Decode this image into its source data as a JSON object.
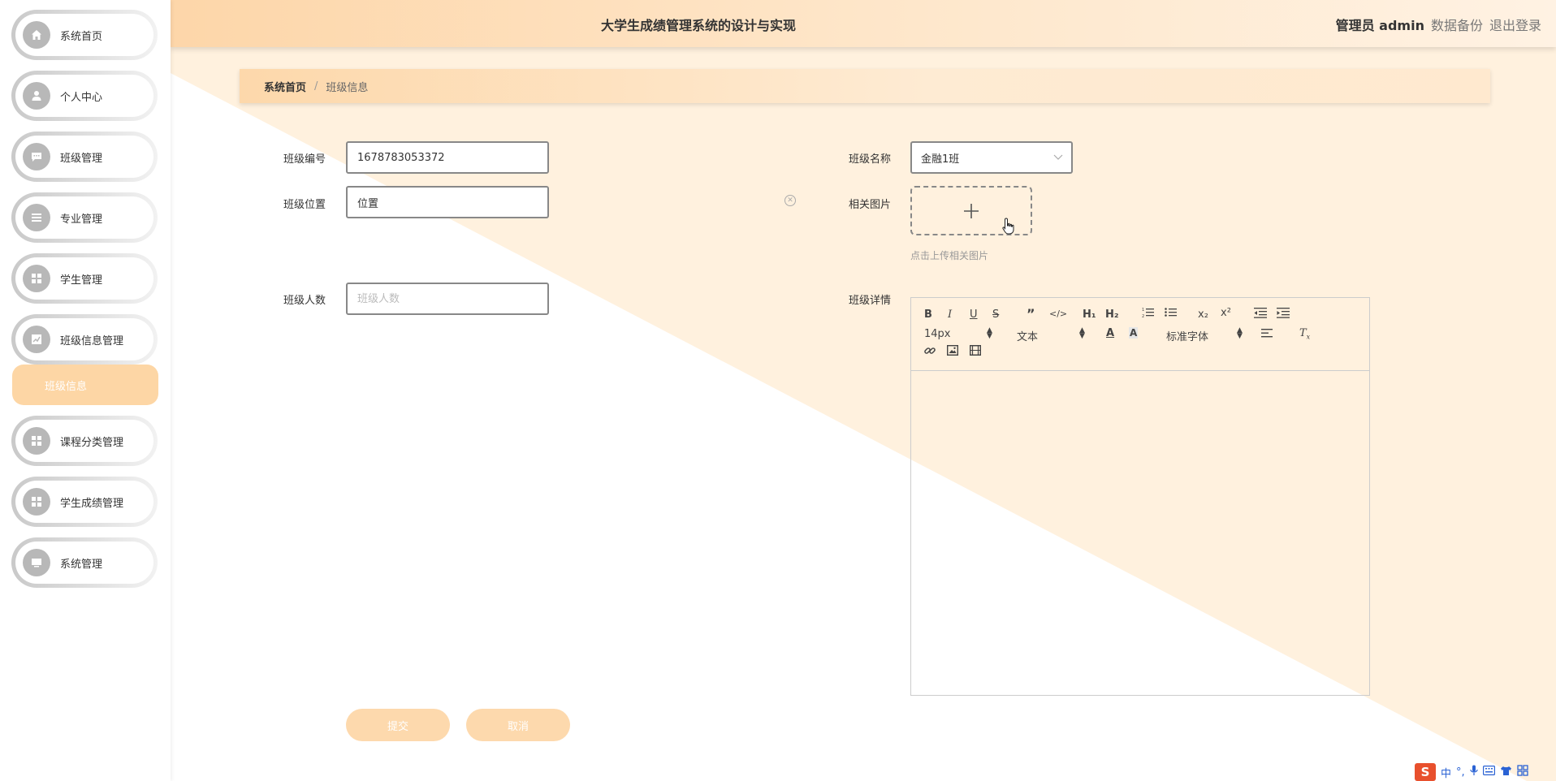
{
  "header": {
    "title": "大学生成绩管理系统的设计与实现",
    "user_label": "管理员 admin",
    "backup_label": "数据备份",
    "logout_label": "退出登录"
  },
  "sidebar": {
    "items": [
      {
        "label": "系统首页",
        "icon": "home-icon"
      },
      {
        "label": "个人中心",
        "icon": "user-icon"
      },
      {
        "label": "班级管理",
        "icon": "chat-icon"
      },
      {
        "label": "专业管理",
        "icon": "list-icon"
      },
      {
        "label": "学生管理",
        "icon": "grid-icon"
      },
      {
        "label": "班级信息管理",
        "icon": "chart-icon"
      },
      {
        "label": "课程分类管理",
        "icon": "grid-icon"
      },
      {
        "label": "学生成绩管理",
        "icon": "grid-icon"
      },
      {
        "label": "系统管理",
        "icon": "monitor-icon"
      }
    ],
    "active_submenu": "班级信息"
  },
  "breadcrumb": {
    "home": "系统首页",
    "separator": "/",
    "current": "班级信息"
  },
  "form": {
    "class_no_label": "班级编号",
    "class_no_value": "1678783053372",
    "class_location_label": "班级位置",
    "class_location_value": "位置",
    "class_size_label": "班级人数",
    "class_size_placeholder": "班级人数",
    "class_name_label": "班级名称",
    "class_name_value": "金融1班",
    "image_label": "相关图片",
    "upload_hint": "点击上传相关图片",
    "detail_label": "班级详情"
  },
  "editor": {
    "font_size": "14px",
    "paragraph": "文本",
    "font_family": "标准字体"
  },
  "buttons": {
    "submit": "提交",
    "cancel": "取消"
  },
  "ime": {
    "lang": "中",
    "punct": "°,"
  },
  "colors": {
    "accent": "#fdd6a5",
    "header_start": "#fdd6a9",
    "background_diagonal": "#fff1de"
  }
}
